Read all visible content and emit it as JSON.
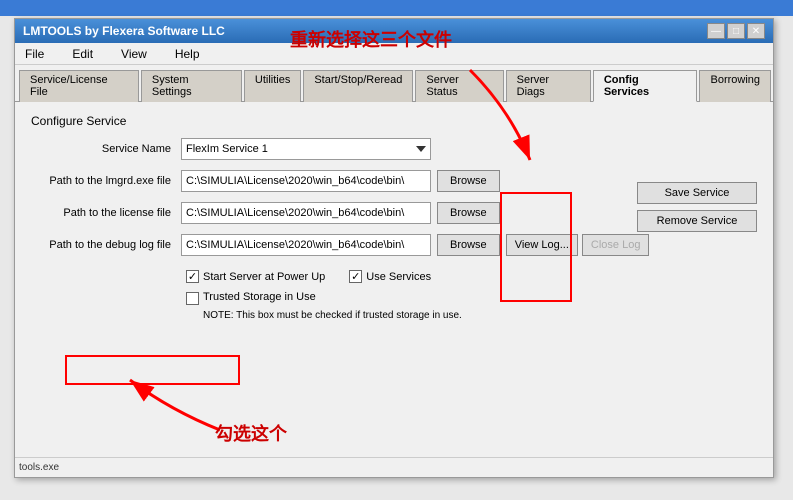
{
  "window": {
    "title": "LMTOOLS by Flexera Software LLC",
    "controls": [
      "—",
      "□",
      "✕"
    ]
  },
  "menu": {
    "items": [
      "File",
      "Edit",
      "View",
      "Help"
    ]
  },
  "tabs": [
    {
      "label": "Service/License File",
      "active": false
    },
    {
      "label": "System Settings",
      "active": false
    },
    {
      "label": "Utilities",
      "active": false
    },
    {
      "label": "Start/Stop/Reread",
      "active": false
    },
    {
      "label": "Server Status",
      "active": false
    },
    {
      "label": "Server Diags",
      "active": false
    },
    {
      "label": "Config Services",
      "active": true
    },
    {
      "label": "Borrowing",
      "active": false
    }
  ],
  "content": {
    "section_label": "Configure Service",
    "service_name_label": "Service Name",
    "service_name_value": "FlexIm Service 1",
    "lmgrd_label": "Path to the lmgrd.exe file",
    "lmgrd_value": "C:\\SIMULIA\\License\\2020\\win_b64\\code\\bin\\",
    "license_label": "Path to the license file",
    "license_value": "C:\\SIMULIA\\License\\2020\\win_b64\\code\\bin\\",
    "debug_label": "Path to the debug log file",
    "debug_value": "C:\\SIMULIA\\License\\2020\\win_b64\\code\\bin\\"
  },
  "buttons": {
    "save_service": "Save Service",
    "remove_service": "Remove Service",
    "browse": "Browse",
    "view_log": "View Log...",
    "close_log": "Close Log"
  },
  "checkboxes": {
    "start_server": {
      "label": "Start Server at Power Up",
      "checked": true
    },
    "use_services": {
      "label": "Use Services",
      "checked": true
    },
    "trusted_storage": {
      "label": "Trusted Storage in Use",
      "checked": false
    }
  },
  "trusted_note": "NOTE: This box must be checked if trusted storage in use.",
  "annotations": {
    "top_text": "重新选择这三个文件",
    "bottom_text": "勾选这个"
  },
  "status_bar": {
    "text": "tools.exe"
  }
}
